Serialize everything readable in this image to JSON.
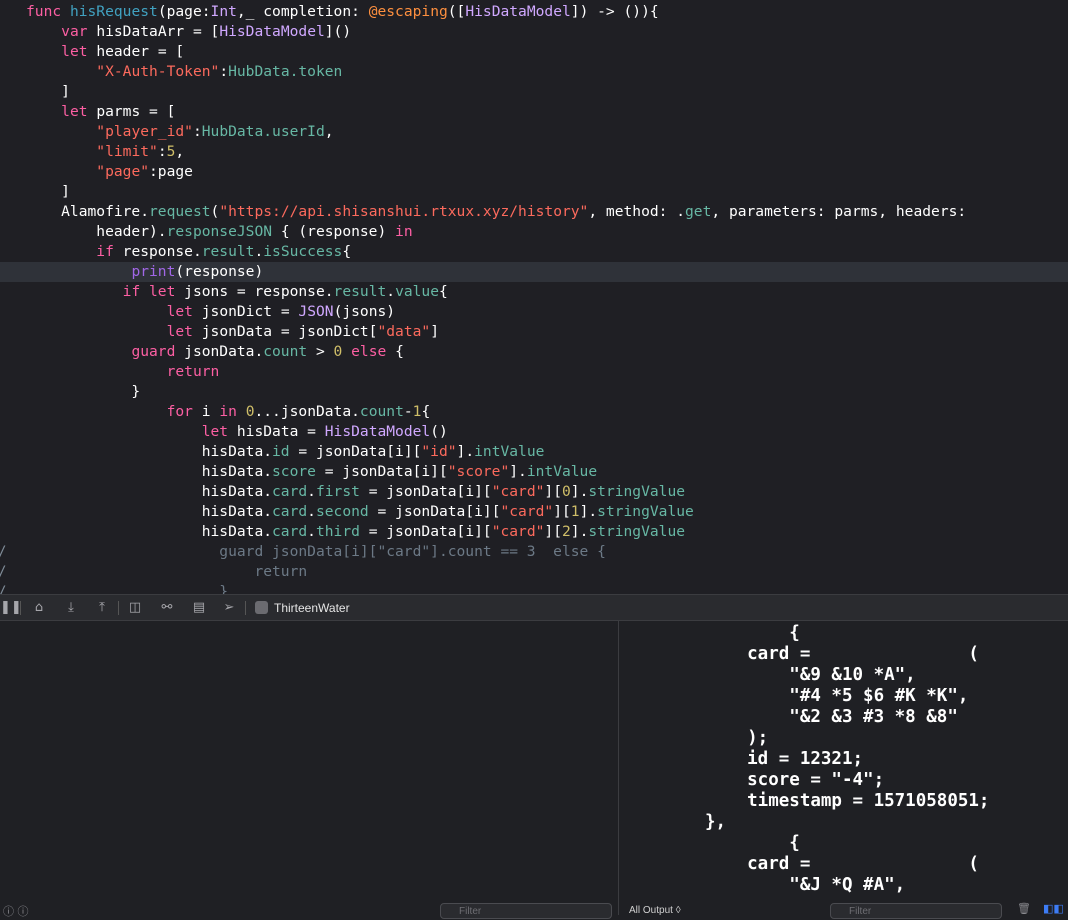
{
  "editor": {
    "lines": [
      {
        "gutter": "",
        "tokens": [
          [
            "kw",
            "func "
          ],
          [
            "fn",
            "hisRequest"
          ],
          [
            "plain",
            "(page:"
          ],
          [
            "type",
            "Int"
          ],
          [
            "plain",
            ",_ completion: "
          ],
          [
            "attr",
            "@escaping"
          ],
          [
            "plain",
            "(["
          ],
          [
            "type",
            "HisDataModel"
          ],
          [
            "plain",
            "]) -> ()){"
          ]
        ]
      },
      {
        "gutter": "",
        "tokens": [
          [
            "plain",
            "    "
          ],
          [
            "kw",
            "var "
          ],
          [
            "plain",
            "hisDataArr = ["
          ],
          [
            "type",
            "HisDataModel"
          ],
          [
            "plain",
            "]()"
          ]
        ]
      },
      {
        "gutter": "",
        "tokens": [
          [
            "plain",
            "    "
          ],
          [
            "kw",
            "let "
          ],
          [
            "plain",
            "header = ["
          ]
        ]
      },
      {
        "gutter": "",
        "tokens": [
          [
            "plain",
            "        "
          ],
          [
            "str",
            "\"X-Auth-Token\""
          ],
          [
            "plain",
            ":"
          ],
          [
            "prop",
            "HubData.token"
          ]
        ]
      },
      {
        "gutter": "",
        "tokens": [
          [
            "plain",
            "    ]"
          ]
        ]
      },
      {
        "gutter": "",
        "tokens": [
          [
            "plain",
            "    "
          ],
          [
            "kw",
            "let "
          ],
          [
            "plain",
            "parms = ["
          ]
        ]
      },
      {
        "gutter": "",
        "tokens": [
          [
            "plain",
            "        "
          ],
          [
            "str",
            "\"player_id\""
          ],
          [
            "plain",
            ":"
          ],
          [
            "prop",
            "HubData.userId"
          ],
          [
            "plain",
            ","
          ]
        ]
      },
      {
        "gutter": "",
        "tokens": [
          [
            "plain",
            "        "
          ],
          [
            "str",
            "\"limit\""
          ],
          [
            "plain",
            ":"
          ],
          [
            "num",
            "5"
          ],
          [
            "plain",
            ","
          ]
        ]
      },
      {
        "gutter": "",
        "tokens": [
          [
            "plain",
            "        "
          ],
          [
            "str",
            "\"page\""
          ],
          [
            "plain",
            ":page"
          ]
        ]
      },
      {
        "gutter": "",
        "tokens": [
          [
            "plain",
            "    ]"
          ]
        ]
      },
      {
        "gutter": "",
        "tokens": [
          [
            "plain",
            "    Alamofire."
          ],
          [
            "prop",
            "request"
          ],
          [
            "plain",
            "("
          ],
          [
            "str",
            "\"https://api.shisanshui.rtxux.xyz/history\""
          ],
          [
            "plain",
            ", method: ."
          ],
          [
            "prop",
            "get"
          ],
          [
            "plain",
            ", parameters: parms, headers:"
          ]
        ]
      },
      {
        "gutter": "",
        "tokens": [
          [
            "plain",
            "        header)."
          ],
          [
            "prop",
            "responseJSON"
          ],
          [
            "plain",
            " { (response) "
          ],
          [
            "kw",
            "in"
          ]
        ]
      },
      {
        "gutter": "",
        "tokens": [
          [
            "plain",
            "        "
          ],
          [
            "kw",
            "if "
          ],
          [
            "plain",
            "response."
          ],
          [
            "prop",
            "result"
          ],
          [
            "plain",
            "."
          ],
          [
            "prop",
            "isSuccess"
          ],
          [
            "plain",
            "{"
          ]
        ]
      },
      {
        "gutter": "",
        "current": true,
        "tokens": [
          [
            "plain",
            "            "
          ],
          [
            "method",
            "print"
          ],
          [
            "plain",
            "(response)"
          ]
        ]
      },
      {
        "gutter": "",
        "tokens": [
          [
            "plain",
            "           "
          ],
          [
            "kw",
            "if let "
          ],
          [
            "plain",
            "jsons = response."
          ],
          [
            "prop",
            "result"
          ],
          [
            "plain",
            "."
          ],
          [
            "prop",
            "value"
          ],
          [
            "plain",
            "{"
          ]
        ]
      },
      {
        "gutter": "",
        "tokens": [
          [
            "plain",
            "                "
          ],
          [
            "kw",
            "let "
          ],
          [
            "plain",
            "jsonDict = "
          ],
          [
            "type",
            "JSON"
          ],
          [
            "plain",
            "(jsons)"
          ]
        ]
      },
      {
        "gutter": "",
        "tokens": [
          [
            "plain",
            "                "
          ],
          [
            "kw",
            "let "
          ],
          [
            "plain",
            "jsonData = jsonDict["
          ],
          [
            "str",
            "\"data\""
          ],
          [
            "plain",
            "]"
          ]
        ]
      },
      {
        "gutter": "",
        "tokens": [
          [
            "plain",
            "            "
          ],
          [
            "kw",
            "guard "
          ],
          [
            "plain",
            "jsonData."
          ],
          [
            "prop",
            "count"
          ],
          [
            "plain",
            " > "
          ],
          [
            "num",
            "0"
          ],
          [
            "plain",
            " "
          ],
          [
            "kw",
            "else"
          ],
          [
            "plain",
            " {"
          ]
        ]
      },
      {
        "gutter": "",
        "tokens": [
          [
            "plain",
            "                "
          ],
          [
            "kw",
            "return"
          ]
        ]
      },
      {
        "gutter": "",
        "tokens": [
          [
            "plain",
            "            }"
          ]
        ]
      },
      {
        "gutter": "",
        "tokens": [
          [
            "plain",
            "                "
          ],
          [
            "kw",
            "for "
          ],
          [
            "plain",
            "i "
          ],
          [
            "kw",
            "in "
          ],
          [
            "num",
            "0"
          ],
          [
            "plain",
            "..."
          ],
          [
            "plain",
            "jsonData."
          ],
          [
            "prop",
            "count"
          ],
          [
            "plain",
            "-"
          ],
          [
            "num",
            "1"
          ],
          [
            "plain",
            "{"
          ]
        ]
      },
      {
        "gutter": "",
        "tokens": [
          [
            "plain",
            "                    "
          ],
          [
            "kw",
            "let "
          ],
          [
            "plain",
            "hisData = "
          ],
          [
            "type",
            "HisDataModel"
          ],
          [
            "plain",
            "()"
          ]
        ]
      },
      {
        "gutter": "",
        "tokens": [
          [
            "plain",
            "                    hisData."
          ],
          [
            "prop",
            "id"
          ],
          [
            "plain",
            " = jsonData[i]["
          ],
          [
            "str",
            "\"id\""
          ],
          [
            "plain",
            "]."
          ],
          [
            "prop",
            "intValue"
          ]
        ]
      },
      {
        "gutter": "",
        "tokens": [
          [
            "plain",
            "                    hisData."
          ],
          [
            "prop",
            "score"
          ],
          [
            "plain",
            " = jsonData[i]["
          ],
          [
            "str",
            "\"score\""
          ],
          [
            "plain",
            "]."
          ],
          [
            "prop",
            "intValue"
          ]
        ]
      },
      {
        "gutter": "",
        "tokens": [
          [
            "plain",
            "                    hisData."
          ],
          [
            "prop",
            "card"
          ],
          [
            "plain",
            "."
          ],
          [
            "prop",
            "first"
          ],
          [
            "plain",
            " = jsonData[i]["
          ],
          [
            "str",
            "\"card\""
          ],
          [
            "plain",
            "]["
          ],
          [
            "num",
            "0"
          ],
          [
            "plain",
            "]."
          ],
          [
            "prop",
            "stringValue"
          ]
        ]
      },
      {
        "gutter": "",
        "tokens": [
          [
            "plain",
            "                    hisData."
          ],
          [
            "prop",
            "card"
          ],
          [
            "plain",
            "."
          ],
          [
            "prop",
            "second"
          ],
          [
            "plain",
            " = jsonData[i]["
          ],
          [
            "str",
            "\"card\""
          ],
          [
            "plain",
            "]["
          ],
          [
            "num",
            "1"
          ],
          [
            "plain",
            "]."
          ],
          [
            "prop",
            "stringValue"
          ]
        ]
      },
      {
        "gutter": "",
        "tokens": [
          [
            "plain",
            "                    hisData."
          ],
          [
            "prop",
            "card"
          ],
          [
            "plain",
            "."
          ],
          [
            "prop",
            "third"
          ],
          [
            "plain",
            " = jsonData[i]["
          ],
          [
            "str",
            "\"card\""
          ],
          [
            "plain",
            "]["
          ],
          [
            "num",
            "2"
          ],
          [
            "plain",
            "]."
          ],
          [
            "prop",
            "stringValue"
          ]
        ]
      },
      {
        "gutter": "/",
        "tokens": [
          [
            "comment",
            "                      guard jsonData[i][\"card\"].count == 3  else {"
          ]
        ]
      },
      {
        "gutter": "/",
        "tokens": [
          [
            "comment",
            "                          return"
          ]
        ]
      },
      {
        "gutter": "/",
        "tokens": [
          [
            "comment",
            "                      }"
          ]
        ]
      }
    ]
  },
  "debug_bar": {
    "app_name": "ThirteenWater",
    "icons": [
      "pause-icon",
      "step-over-icon",
      "step-into-icon",
      "step-out-icon",
      "view-hierarchy-icon",
      "memory-graph-icon",
      "environment-icon",
      "location-icon"
    ]
  },
  "console": {
    "lines": [
      "        {",
      "    card =               (",
      "        \"&9 &10 *A\",",
      "        \"#4 *5 $6 #K *K\",",
      "        \"&2 &3 #3 *8 &8\"",
      "    );",
      "    id = 12321;",
      "    score = \"-4\";",
      "    timestamp = 1571058051;",
      "},",
      "        {",
      "    card =               (",
      "        \"&J *Q #A\","
    ]
  },
  "bottom": {
    "filter_placeholder": "Filter",
    "output_selector": "All Output ◊"
  }
}
